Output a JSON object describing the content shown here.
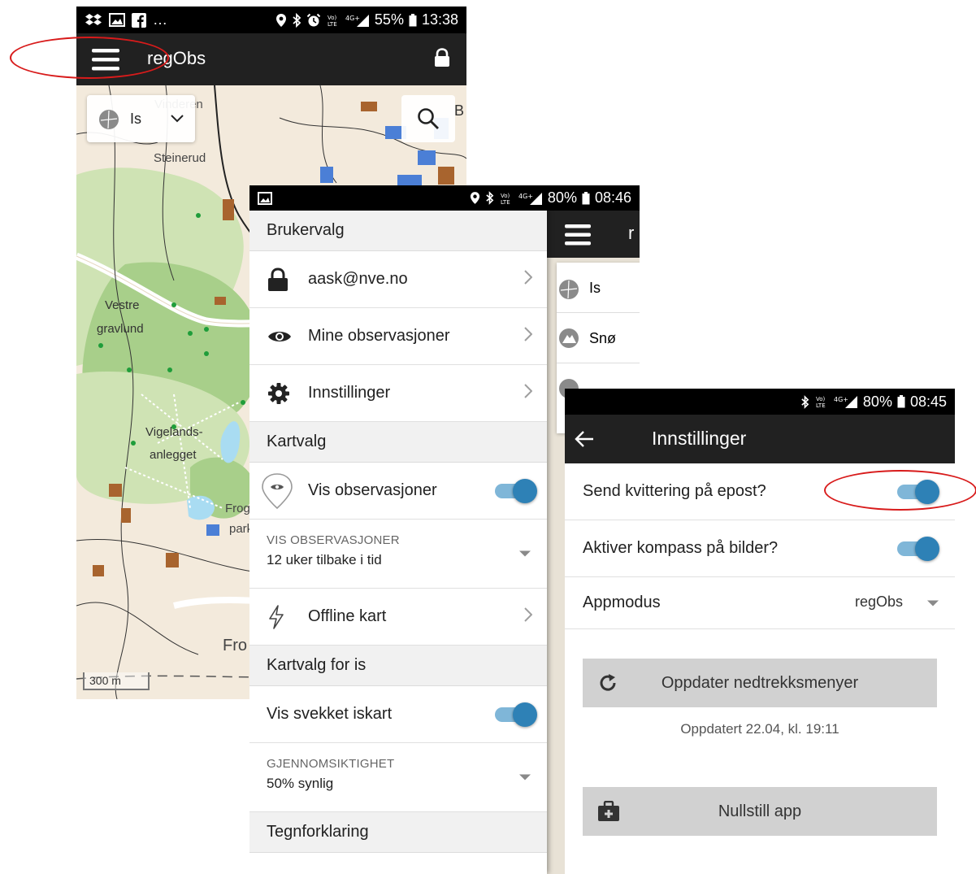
{
  "phone_map": {
    "status": {
      "notifications": "…",
      "battery": "55%",
      "time": "13:38"
    },
    "app_title": "regObs",
    "layer_select": {
      "value": "Is"
    },
    "map_labels": [
      "Vinderen",
      "Steinerud",
      "Vestre",
      "gravlund",
      "Vigelands-",
      "anlegget",
      "Frogner",
      "park",
      "Fro"
    ],
    "partial_label": "B",
    "scale": "300 m"
  },
  "phone_menu": {
    "status": {
      "battery": "80%",
      "time": "08:46"
    },
    "behind": {
      "title_partial": "r",
      "items": [
        "Is",
        "Snø"
      ]
    },
    "sections": {
      "user": "Brukervalg",
      "map": "Kartvalg",
      "ice": "Kartvalg for is",
      "legend": "Tegnforklaring"
    },
    "items": {
      "account": "aask@nve.no",
      "observations": "Mine observasjoner",
      "settings": "Innstillinger",
      "show_obs": "Vis observasjoner",
      "offline": "Offline kart",
      "weak_ice": "Vis svekket iskart"
    },
    "obs_period": {
      "label": "VIS OBSERVASJONER",
      "value": "12 uker tilbake i tid"
    },
    "transparency": {
      "label": "GJENNOMSIKTIGHET",
      "value": "50% synlig"
    }
  },
  "phone_settings": {
    "status": {
      "battery": "80%",
      "time": "08:45"
    },
    "title": "Innstillinger",
    "send_receipt": "Send kvittering på epost?",
    "compass": "Aktiver kompass på bilder?",
    "app_mode": {
      "label": "Appmodus",
      "value": "regObs"
    },
    "update_button": "Oppdater nedtrekksmenyer",
    "updated_text": "Oppdatert 22.04, kl. 19:11",
    "reset_button": "Nullstill app"
  },
  "colors": {
    "accent": "#2e81b6",
    "appbar": "#212121",
    "highlight": "#d81b1b"
  }
}
